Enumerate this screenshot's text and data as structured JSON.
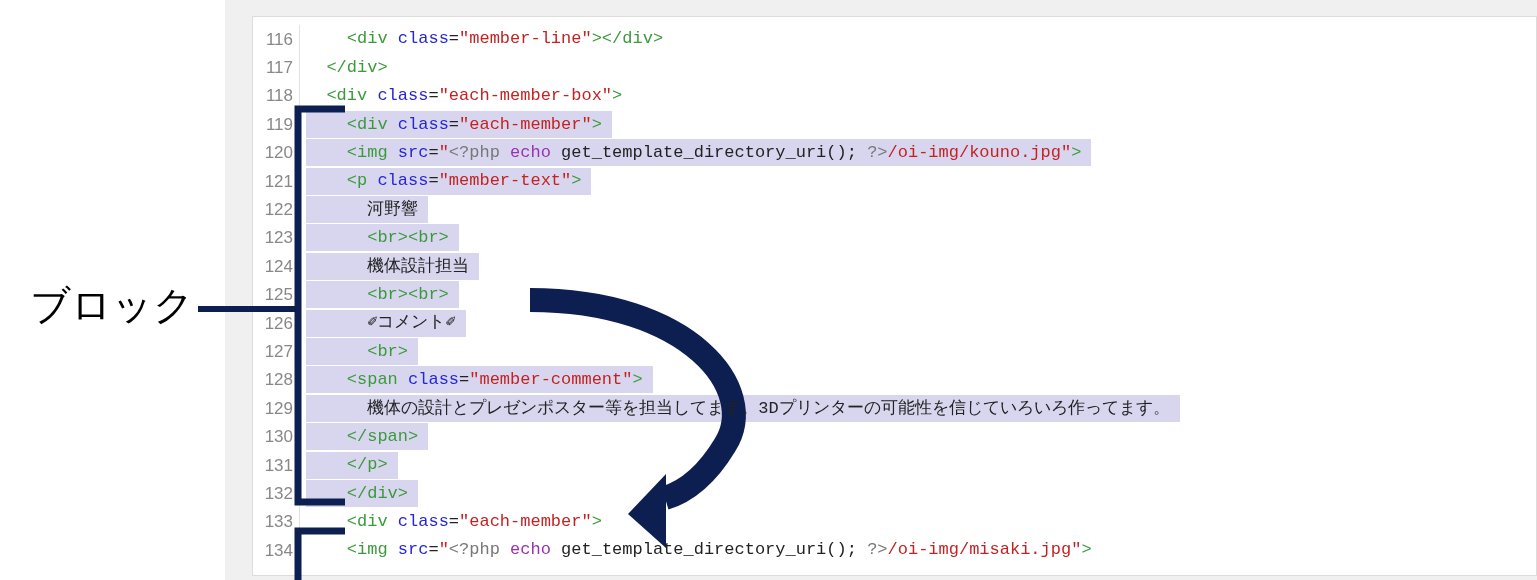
{
  "annotation": {
    "label": "ブロック"
  },
  "editor": {
    "lines": [
      {
        "number": "116",
        "selected": false,
        "tokens": [
          {
            "kind": "tag",
            "text": "    <div"
          },
          {
            "kind": "attr",
            "text": " class"
          },
          {
            "kind": "plain",
            "text": "="
          },
          {
            "kind": "string",
            "text": "\"member-line\""
          },
          {
            "kind": "tag",
            "text": "></div>"
          }
        ]
      },
      {
        "number": "117",
        "selected": false,
        "tokens": [
          {
            "kind": "tag",
            "text": "  </div>"
          }
        ]
      },
      {
        "number": "118",
        "selected": false,
        "tokens": [
          {
            "kind": "tag",
            "text": "  <div"
          },
          {
            "kind": "attr",
            "text": " class"
          },
          {
            "kind": "plain",
            "text": "="
          },
          {
            "kind": "string",
            "text": "\"each-member-box\""
          },
          {
            "kind": "tag",
            "text": ">"
          }
        ]
      },
      {
        "number": "119",
        "selected": true,
        "tokens": [
          {
            "kind": "tag",
            "text": "    <div"
          },
          {
            "kind": "attr",
            "text": " class"
          },
          {
            "kind": "plain",
            "text": "="
          },
          {
            "kind": "string",
            "text": "\"each-member\""
          },
          {
            "kind": "tag",
            "text": ">"
          }
        ]
      },
      {
        "number": "120",
        "selected": true,
        "tokens": [
          {
            "kind": "tag",
            "text": "    <img"
          },
          {
            "kind": "attr",
            "text": " src"
          },
          {
            "kind": "plain",
            "text": "="
          },
          {
            "kind": "string",
            "text": "\""
          },
          {
            "kind": "php",
            "text": "<?php"
          },
          {
            "kind": "keyword",
            "text": " echo"
          },
          {
            "kind": "plain",
            "text": " get_template_directory_uri(); "
          },
          {
            "kind": "php",
            "text": "?>"
          },
          {
            "kind": "string",
            "text": "/oi-img/kouno.jpg\""
          },
          {
            "kind": "tag",
            "text": ">"
          }
        ]
      },
      {
        "number": "121",
        "selected": true,
        "tokens": [
          {
            "kind": "tag",
            "text": "    <p"
          },
          {
            "kind": "attr",
            "text": " class"
          },
          {
            "kind": "plain",
            "text": "="
          },
          {
            "kind": "string",
            "text": "\"member-text\""
          },
          {
            "kind": "tag",
            "text": ">"
          }
        ]
      },
      {
        "number": "122",
        "selected": true,
        "tokens": [
          {
            "kind": "plain",
            "text": "      河野響"
          }
        ]
      },
      {
        "number": "123",
        "selected": true,
        "tokens": [
          {
            "kind": "tag",
            "text": "      <br><br>"
          }
        ]
      },
      {
        "number": "124",
        "selected": true,
        "tokens": [
          {
            "kind": "plain",
            "text": "      機体設計担当"
          }
        ]
      },
      {
        "number": "125",
        "selected": true,
        "tokens": [
          {
            "kind": "tag",
            "text": "      <br><br>"
          }
        ]
      },
      {
        "number": "126",
        "selected": true,
        "tokens": [
          {
            "kind": "plain",
            "text": "      ✐コメント✐"
          }
        ]
      },
      {
        "number": "127",
        "selected": true,
        "tokens": [
          {
            "kind": "tag",
            "text": "      <br>"
          }
        ]
      },
      {
        "number": "128",
        "selected": true,
        "tokens": [
          {
            "kind": "tag",
            "text": "    <span"
          },
          {
            "kind": "attr",
            "text": " class"
          },
          {
            "kind": "plain",
            "text": "="
          },
          {
            "kind": "string",
            "text": "\"member-comment\""
          },
          {
            "kind": "tag",
            "text": ">"
          }
        ]
      },
      {
        "number": "129",
        "selected": true,
        "tokens": [
          {
            "kind": "plain",
            "text": "      機体の設計とプレゼンポスター等を担当してます。3Dプリンターの可能性を信じていろいろ作ってます。"
          }
        ]
      },
      {
        "number": "130",
        "selected": true,
        "tokens": [
          {
            "kind": "tag",
            "text": "    </span>"
          }
        ]
      },
      {
        "number": "131",
        "selected": true,
        "tokens": [
          {
            "kind": "tag",
            "text": "    </p>"
          }
        ]
      },
      {
        "number": "132",
        "selected": true,
        "tokens": [
          {
            "kind": "tag",
            "text": "    </div>"
          }
        ]
      },
      {
        "number": "133",
        "selected": false,
        "tokens": [
          {
            "kind": "tag",
            "text": "    <div"
          },
          {
            "kind": "attr",
            "text": " class"
          },
          {
            "kind": "plain",
            "text": "="
          },
          {
            "kind": "string",
            "text": "\"each-member\""
          },
          {
            "kind": "tag",
            "text": ">"
          }
        ]
      },
      {
        "number": "134",
        "selected": false,
        "tokens": [
          {
            "kind": "tag",
            "text": "    <img"
          },
          {
            "kind": "attr",
            "text": " src"
          },
          {
            "kind": "plain",
            "text": "="
          },
          {
            "kind": "string",
            "text": "\""
          },
          {
            "kind": "php",
            "text": "<?php"
          },
          {
            "kind": "keyword",
            "text": " echo"
          },
          {
            "kind": "plain",
            "text": " get_template_directory_uri(); "
          },
          {
            "kind": "php",
            "text": "?>"
          },
          {
            "kind": "string",
            "text": "/oi-img/misaki.jpg\""
          },
          {
            "kind": "tag",
            "text": ">"
          }
        ]
      }
    ]
  }
}
